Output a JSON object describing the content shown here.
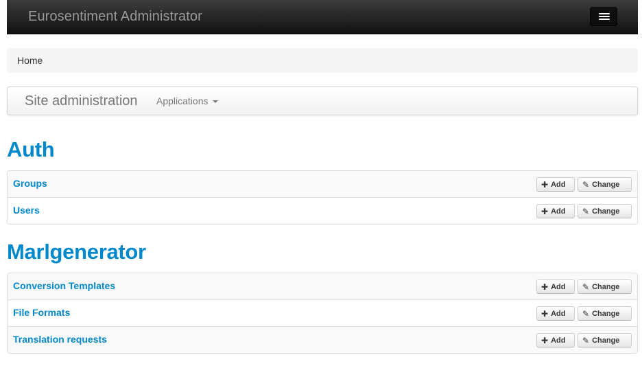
{
  "navbar": {
    "brand": "Eurosentiment Administrator"
  },
  "breadcrumb": {
    "home": "Home"
  },
  "subnav": {
    "title": "Site administration",
    "applications": "Applications"
  },
  "apps": [
    {
      "name": "Auth",
      "models": [
        {
          "name": "Groups",
          "add": "Add",
          "change": "Change"
        },
        {
          "name": "Users",
          "add": "Add",
          "change": "Change"
        }
      ]
    },
    {
      "name": "Marlgenerator",
      "models": [
        {
          "name": "Conversion Templates",
          "add": "Add",
          "change": "Change"
        },
        {
          "name": "File Formats",
          "add": "Add",
          "change": "Change"
        },
        {
          "name": "Translation requests",
          "add": "Add",
          "change": "Change"
        }
      ]
    }
  ],
  "icons": {
    "menu": "menu-icon",
    "add": "plus-icon",
    "change": "edit-icon",
    "dropdown": "caret-down-icon"
  },
  "colors": {
    "link": "#0088cc",
    "navbar": "#222222",
    "muted": "#777777"
  }
}
